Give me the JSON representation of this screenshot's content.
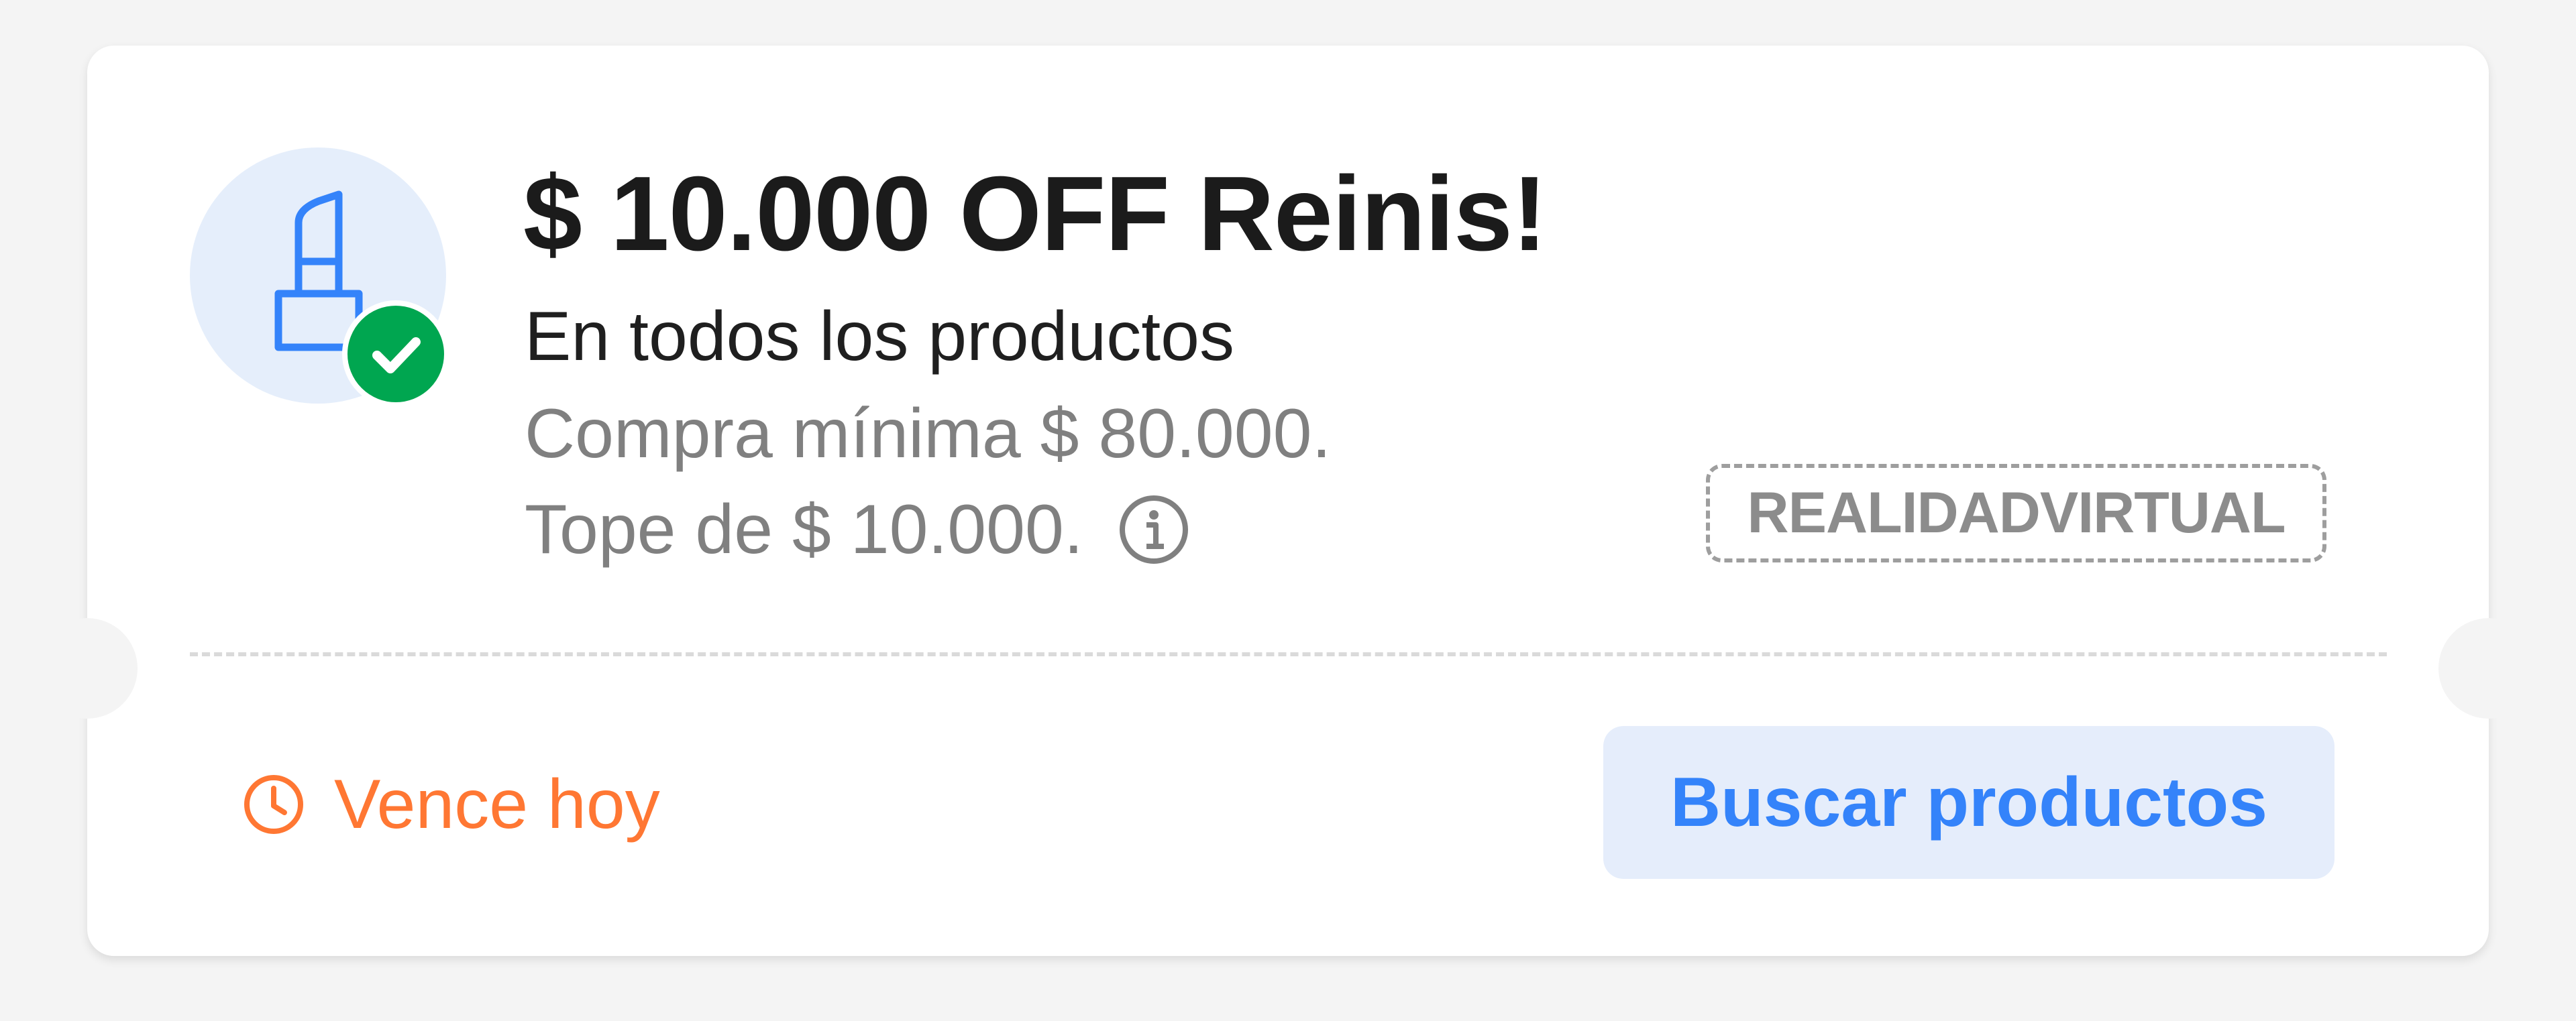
{
  "coupon": {
    "title": "$ 10.000 OFF Reinis!",
    "subtitle": "En todos los productos",
    "min_purchase": "Compra mínima $ 80.000.",
    "cap": "Tope de $ 10.000.",
    "code": "REALIDADVIRTUAL",
    "expiry": "Vence hoy",
    "action_label": "Buscar productos",
    "icons": {
      "product": "lipstick-icon",
      "status": "check-icon",
      "info": "info-icon",
      "expiry": "clock-icon"
    },
    "colors": {
      "accent": "#3483fa",
      "accent_bg": "#e5edfb",
      "success": "#00a650",
      "warning": "#ff7733",
      "icon_bg": "#e5eefb"
    }
  }
}
